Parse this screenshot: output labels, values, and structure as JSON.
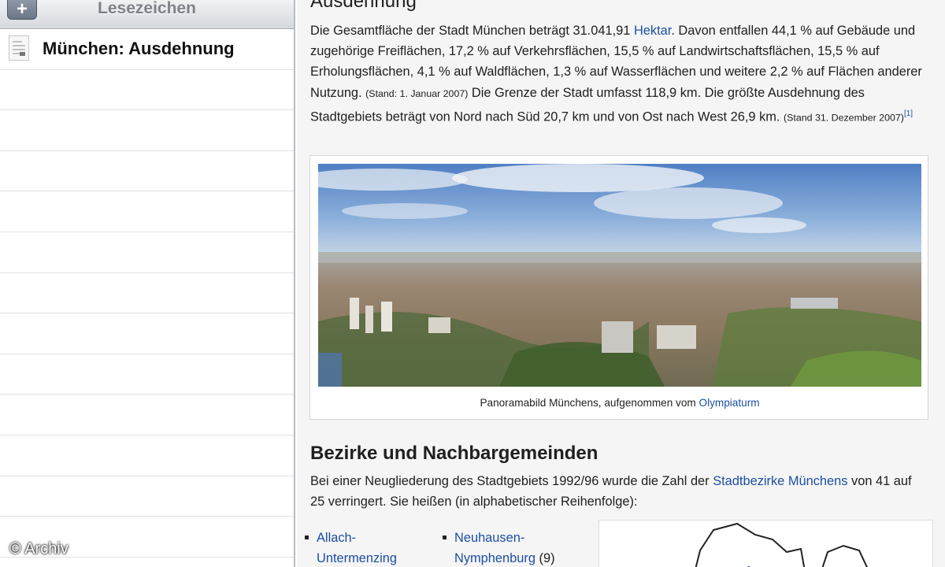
{
  "sidebar": {
    "title": "Lesezeichen",
    "add_label": "+",
    "items": [
      {
        "label": "München: Ausdehnung"
      }
    ]
  },
  "watermark": "© Archiv",
  "article": {
    "section1_heading": "Ausdehnung",
    "p1": {
      "t1": "Die Gesamtfläche der Stadt München beträgt 31.041,91 ",
      "link_hektar": "Hektar",
      "t2": ". Davon entfallen 44,1 % auf Gebäude und zugehörige Freiflächen, 17,2 % auf Verkehrsflächen, 15,5 % auf Landwirtschaftsflächen, 15,5 % auf Erholungsflächen, 4,1 % auf Waldflächen, 1,3 % auf Wasserflächen und weitere 2,2 % auf Flächen anderer Nutzung. ",
      "stand1": "(Stand: 1. Januar 2007)",
      "t3": " Die Grenze der Stadt umfasst 118,9 km. Die größte Ausdehnung des Stadtgebiets beträgt von Nord nach Süd 20,7 km und von Ost nach West 26,9 km. ",
      "stand2": "(Stand 31. Dezember 2007)",
      "ref": "[1]"
    },
    "figure": {
      "caption_text": "Panoramabild Münchens, aufgenommen vom ",
      "caption_link": "Olympiaturm"
    },
    "section2_heading": "Bezirke und Nachbargemeinden",
    "p2": {
      "t1": "Bei einer Neugliederung des Stadtgebiets 1992/96 wurde die Zahl der ",
      "link": "Stadtbezirke Münchens",
      "t2": " von 41 auf 25 verringert. Sie heißen (in alphabetischer Reihenfolge):"
    },
    "districts": [
      {
        "line1": "Allach-",
        "line2": "Untermenzing",
        "count": ""
      },
      {
        "line1": "Neuhausen-",
        "line2": "Nymphenburg",
        "count": " (9)"
      }
    ]
  }
}
